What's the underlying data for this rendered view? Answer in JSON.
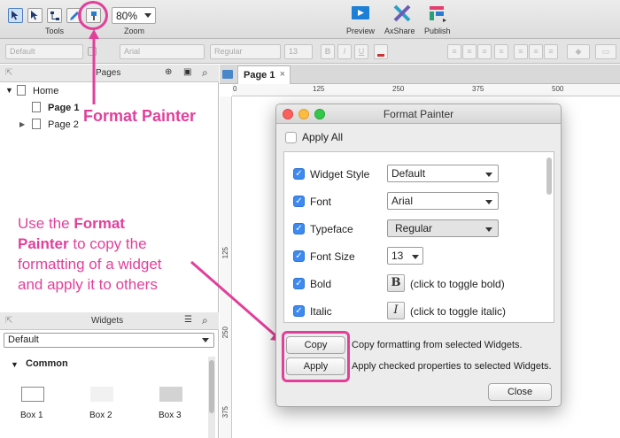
{
  "toolbar": {
    "tools_label": "Tools",
    "zoom_label": "Zoom",
    "zoom_value": "80%",
    "preview_label": "Preview",
    "axshare_label": "AxShare",
    "publish_label": "Publish"
  },
  "stylebar": {
    "style_value": "Default",
    "font_value": "Arial",
    "typeface_value": "Regular",
    "size_value": "13",
    "bold_label": "B",
    "italic_label": "I",
    "underline_label": "U"
  },
  "pages": {
    "title": "Pages",
    "items": [
      {
        "label": "Home"
      },
      {
        "label": "Page 1"
      },
      {
        "label": "Page 2"
      }
    ]
  },
  "widgets": {
    "title": "Widgets",
    "library": "Default",
    "group": "Common",
    "items": [
      {
        "label": "Box 1"
      },
      {
        "label": "Box 2"
      },
      {
        "label": "Box 3"
      }
    ]
  },
  "canvas": {
    "tab_label": "Page 1",
    "ruler_h": [
      "0",
      "125",
      "250",
      "375",
      "500"
    ],
    "ruler_v": [
      "125",
      "250",
      "375"
    ]
  },
  "dialog": {
    "title": "Format Painter",
    "apply_all": "Apply All",
    "properties": [
      {
        "label": "Widget Style",
        "value": "Default"
      },
      {
        "label": "Font",
        "value": "Arial"
      },
      {
        "label": "Typeface",
        "value": "Regular"
      },
      {
        "label": "Font Size",
        "value": "13"
      },
      {
        "label": "Bold",
        "icon": "B",
        "hint": "(click to toggle bold)"
      },
      {
        "label": "Italic",
        "icon": "I",
        "hint": "(click to toggle italic)"
      }
    ],
    "copy_label": "Copy",
    "copy_desc": "Copy formatting from selected Widgets.",
    "apply_label": "Apply",
    "apply_desc": "Apply checked properties to selected Widgets.",
    "close_label": "Close"
  },
  "annotations": {
    "format_painter": "Format Painter",
    "text_line1_pre": "Use the ",
    "text_line1_bold": "Format",
    "text_line2_bold": "Painter",
    "text_line2_post": " to copy the",
    "text_line3": "formatting of a widget",
    "text_line4": "and apply it to others"
  },
  "colors": {
    "accent_pink": "#e23f9b",
    "checkbox_blue": "#3d8bf0"
  }
}
